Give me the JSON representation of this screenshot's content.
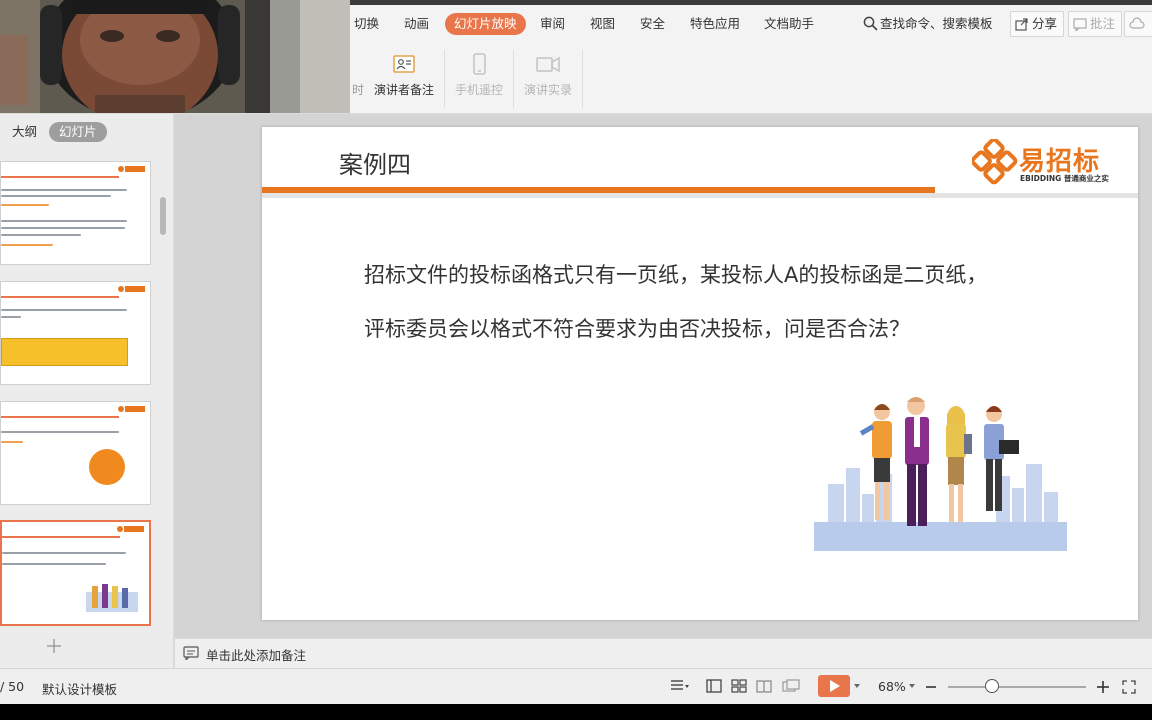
{
  "ribbon_tabs": [
    {
      "label": "切换"
    },
    {
      "label": "动画"
    },
    {
      "label": "幻灯片放映"
    },
    {
      "label": "审阅"
    },
    {
      "label": "视图"
    },
    {
      "label": "安全"
    },
    {
      "label": "特色应用"
    },
    {
      "label": "文档助手"
    }
  ],
  "active_tab": "幻灯片放映",
  "search_label": "查找命令、搜索模板",
  "share_label": "分享",
  "comment_label": "批注",
  "ribbon_buttons": {
    "partial_label": "时",
    "presenter_notes": "演讲者备注",
    "phone_remote": "手机遥控",
    "record_speech": "演讲实录"
  },
  "left_panel": {
    "tab_outline": "大纲",
    "tab_slides": "幻灯片",
    "selected_thumb": 4
  },
  "slide": {
    "title": "案例四",
    "logo_text": "易招标",
    "logo_sub": "EBIDDING 普通商业之实",
    "line1": "招标文件的投标函格式只有一页纸，某投标人A的投标函是二页纸，",
    "line2": "评标委员会以格式不符合要求为由否决投标，问是否合法？"
  },
  "notes_placeholder": "单击此处添加备注",
  "status": {
    "page_count": "/ 50",
    "template": "默认设计模板",
    "zoom": "68%"
  },
  "colors": {
    "accent": "#e8764a",
    "brand_orange": "#e8761e"
  }
}
